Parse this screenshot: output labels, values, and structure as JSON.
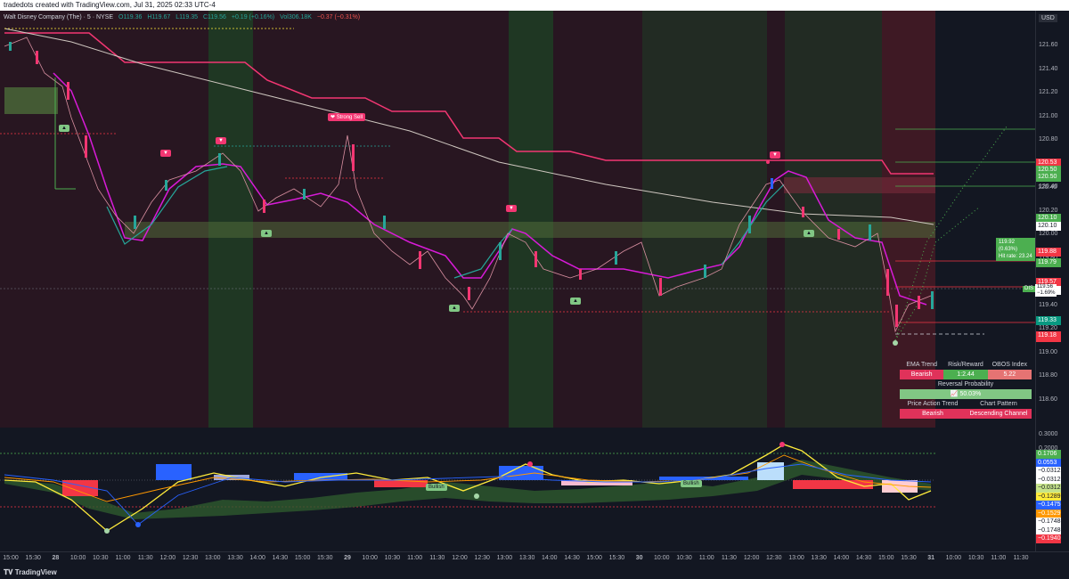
{
  "header": {
    "text": "tradedots created with TradingView.com, Jul 31, 2025 02:33 UTC-4"
  },
  "legend": {
    "symbol": "Walt Disney Company (The) · 5 · NYSE",
    "open": "O119.36",
    "high": "H119.67",
    "low": "L119.35",
    "close": "C119.56",
    "change": "+0.19 (+0.16%)",
    "volume": "Vol306.18K",
    "vol_change": "−0.37 (−0.31%)"
  },
  "currency": "USD",
  "price_ticks": [
    "121.60",
    "121.40",
    "121.20",
    "121.00",
    "120.80",
    "120.60",
    "120.40",
    "120.20",
    "120.00",
    "119.80",
    "119.60",
    "119.40",
    "119.20",
    "119.00",
    "118.80",
    "118.60"
  ],
  "price_labels": [
    {
      "text": "120.53",
      "color": "#f23645"
    },
    {
      "text": "120.50",
      "color": "#4caf50"
    },
    {
      "text": "120.50",
      "color": "#4caf50"
    },
    {
      "text": "120.40",
      "color": "none"
    },
    {
      "text": "120.10",
      "color": "#4caf50"
    },
    {
      "text": "120.10",
      "color": "#ffffff"
    },
    {
      "text": "119.88",
      "color": "#f23645"
    },
    {
      "text": "119.79",
      "color": "#4caf50"
    },
    {
      "text": "119.57",
      "color": "#f23645"
    },
    {
      "text": "119.56",
      "color": "#ffffff"
    },
    {
      "text": "119.36",
      "color": "#f23645"
    },
    {
      "text": "119.33",
      "color": "#089981"
    },
    {
      "text": "119.18",
      "color": "#f23645"
    }
  ],
  "dis_tag": {
    "symbol": "DIS",
    "price": "119.56",
    "change": "−1.69%"
  },
  "hit_box": {
    "line1": "119.92 (0.63%)",
    "line2": "Hit rate: 23.24"
  },
  "signals": {
    "strong_sell": "Strong Sell",
    "bullish_1": "Bullish",
    "bullish_2": "Bullish"
  },
  "panel": {
    "ema_trend_label": "EMA Trend",
    "rr_label": "Risk/Reward",
    "obos_label": "OBOS Index",
    "ema_trend": "Bearish",
    "rr": "1:2.44",
    "obos": "5.22",
    "rev_label": "Reversal Probability",
    "rev": "50.03%",
    "pa_label": "Price Action Trend",
    "cp_label": "Chart Pattern",
    "pa": "Bearish",
    "cp": "Descending Channel"
  },
  "osc_ticks": [
    "0.3000",
    "0.2000",
    "0.1000"
  ],
  "osc_labels": [
    {
      "text": "0.1706",
      "color": "#4caf50"
    },
    {
      "text": "0.0553",
      "color": "#2962ff"
    },
    {
      "text": "−0.0312",
      "color": "#ffffff"
    },
    {
      "text": "−0.0312",
      "color": "#ffffff"
    },
    {
      "text": "−0.0312",
      "color": "#c6e48b"
    },
    {
      "text": "−0.1289",
      "color": "#ffeb3b"
    },
    {
      "text": "−0.1475",
      "color": "#2962ff"
    },
    {
      "text": "−0.1529",
      "color": "#ff9800"
    },
    {
      "text": "−0.1748",
      "color": "#ffffff"
    },
    {
      "text": "−0.1748",
      "color": "#ffffff"
    },
    {
      "text": "−0.1940",
      "color": "#f23645"
    }
  ],
  "time_ticks": [
    "15:00",
    "15:30",
    "28",
    "10:00",
    "10:30",
    "11:00",
    "11:30",
    "12:00",
    "12:30",
    "13:00",
    "13:30",
    "14:00",
    "14:30",
    "15:00",
    "15:30",
    "29",
    "10:00",
    "10:30",
    "11:00",
    "11:30",
    "12:00",
    "12:30",
    "13:00",
    "13:30",
    "14:00",
    "14:30",
    "15:00",
    "15:30",
    "30",
    "10:00",
    "10:30",
    "11:00",
    "11:30",
    "12:00",
    "12:30",
    "13:00",
    "13:30",
    "14:00",
    "14:30",
    "15:00",
    "15:30",
    "31",
    "10:00",
    "10:30",
    "11:00",
    "11:30"
  ],
  "footer": {
    "brand": "TradingView"
  }
}
